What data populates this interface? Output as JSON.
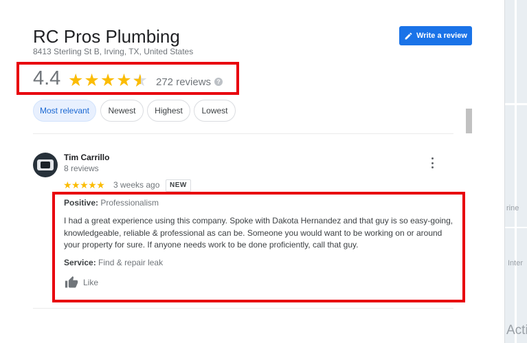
{
  "business": {
    "name": "RC Pros Plumbing",
    "address": "8413 Sterling St B, Irving, TX, United States",
    "rating": "4.4",
    "stars": "★★★★",
    "half_star": "★",
    "review_count": "272 reviews",
    "rating_value": 4.4
  },
  "toolbar": {
    "write_review_label": "Write a review",
    "help_glyph": "?"
  },
  "sort_chips": [
    {
      "label": "Most relevant",
      "active": true
    },
    {
      "label": "Newest",
      "active": false
    },
    {
      "label": "Highest",
      "active": false
    },
    {
      "label": "Lowest",
      "active": false
    }
  ],
  "review": {
    "author": "Tim Carrillo",
    "author_meta": "8 reviews",
    "stars": "★★★★★",
    "rating_value": 5,
    "date": "3 weeks ago",
    "badge": "NEW",
    "positive_label": "Positive:",
    "positive_value": "Professionalism",
    "text": "I had a great experience using this company. Spoke with Dakota Hernandez and that guy is so easy-going, knowledgeable, reliable & professional as can be. Someone you would want to be working on or around your property for sure. If anyone needs work to be done proficiently, call that guy.",
    "service_label": "Service:",
    "service_value": "Find & repair leak",
    "like_label": "Like"
  },
  "map": {
    "labels": [
      "rine",
      "Inter",
      "Acti"
    ]
  },
  "colors": {
    "accent": "#1a73e8",
    "star": "#fbbc04",
    "highlight": "#e8000b",
    "chip_active_bg": "#e8f0fe"
  },
  "icons": [
    "pencil-icon",
    "star-icon",
    "help-icon",
    "more-vert-icon",
    "thumb-up-icon"
  ]
}
